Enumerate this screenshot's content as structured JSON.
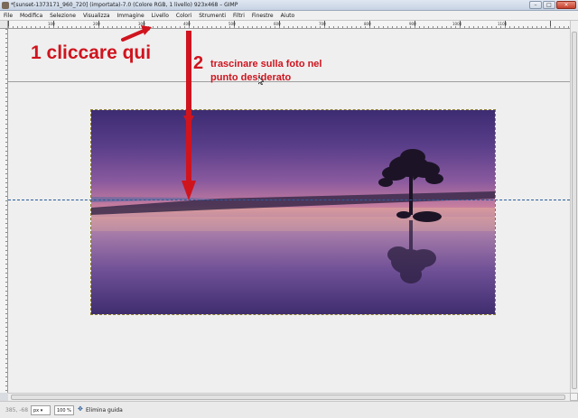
{
  "window": {
    "title": "*[sunset-1373171_960_720] (importata)-7.0 (Colore RGB, 1 livello) 923x468 – GIMP",
    "controls": [
      "–",
      "□",
      "×"
    ]
  },
  "menubar": {
    "items": [
      "File",
      "Modifica",
      "Selezione",
      "Visualizza",
      "Immagine",
      "Livello",
      "Colori",
      "Strumenti",
      "Filtri",
      "Finestre",
      "Aiuto"
    ]
  },
  "ruler": {
    "labels": [
      "100",
      "200",
      "300",
      "400",
      "500",
      "600",
      "700",
      "800",
      "900",
      "1000",
      "1100"
    ]
  },
  "annotations": {
    "step1": "1 cliccare qui",
    "step2_number": "2",
    "step2_text": "trascinare sulla foto nel punto desiderato",
    "color": "#d0141e"
  },
  "statusbar": {
    "coords": "385, -68",
    "unit": "px",
    "zoom": "100 %",
    "message": "Elimina guida",
    "message_icon": "move-guide-icon"
  },
  "colors": {
    "guide": "#2a5d9c",
    "canvas_bg": "#efefef"
  }
}
